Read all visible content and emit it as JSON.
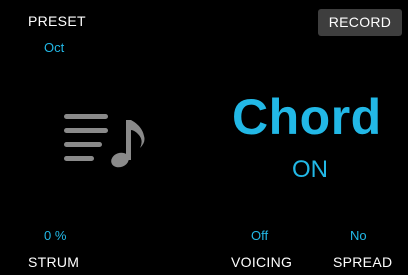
{
  "preset": {
    "label": "PRESET",
    "value": "Oct"
  },
  "record": {
    "label": "RECORD"
  },
  "mode": {
    "icon": "chord-notes-icon",
    "title": "Chord",
    "state": "ON"
  },
  "params": {
    "strum": {
      "label": "STRUM",
      "value": "0 %"
    },
    "voicing": {
      "label": "VOICING",
      "value": "Off"
    },
    "spread": {
      "label": "SPREAD",
      "value": "No"
    }
  },
  "colors": {
    "accent": "#22b8e6",
    "background": "#000000",
    "icon": "#8a8a8a",
    "record_button": "#3e3e3e"
  }
}
